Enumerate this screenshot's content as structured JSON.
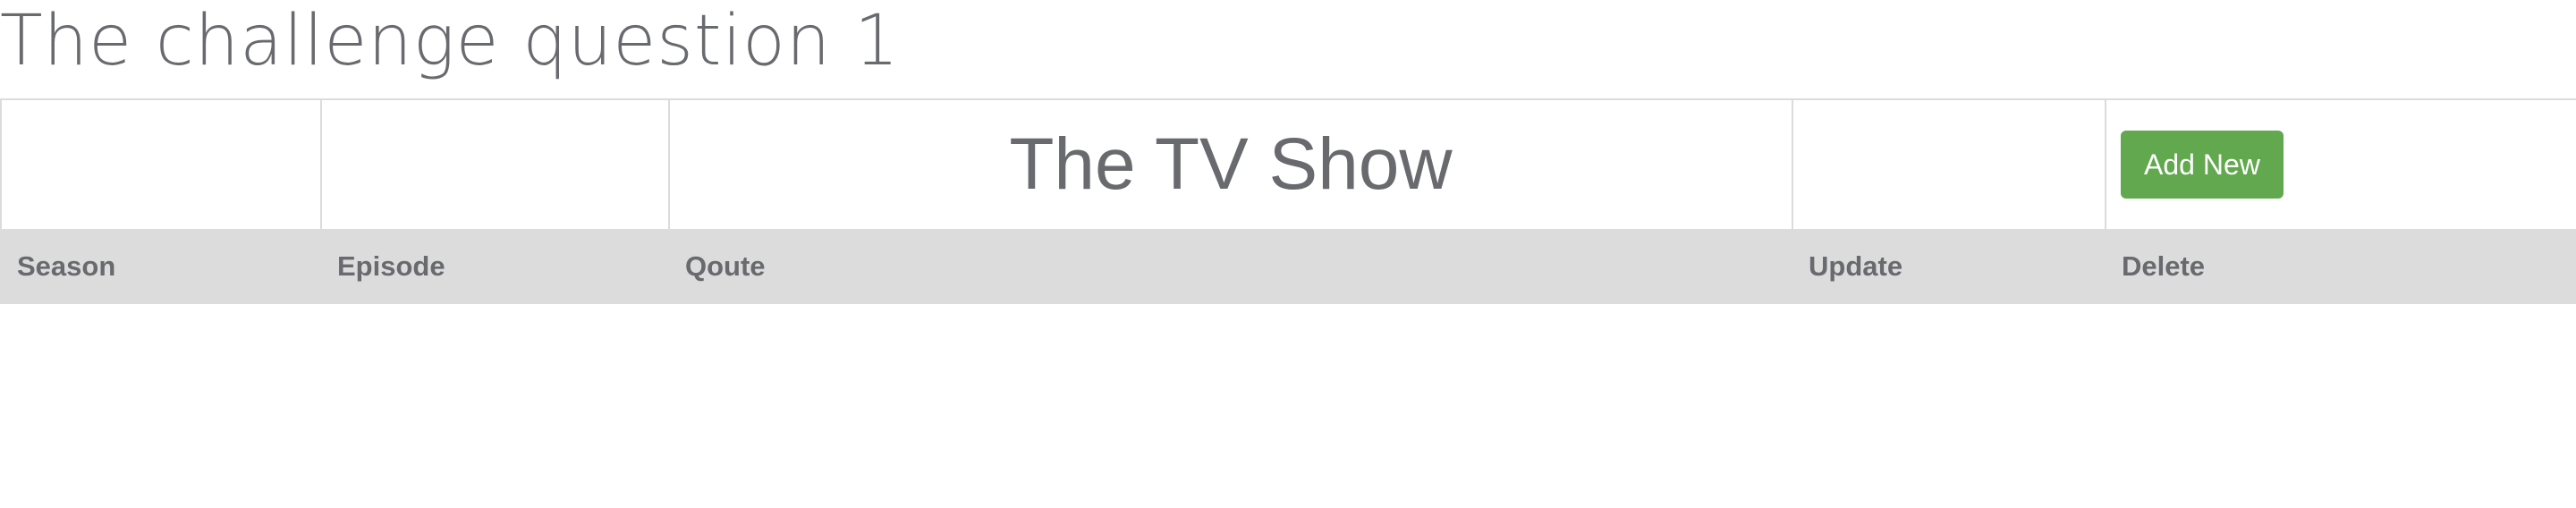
{
  "page": {
    "title": "The challenge question 1"
  },
  "table": {
    "heading": "The TV Show",
    "add_button_label": "Add New",
    "columns": [
      "Season",
      "Episode",
      "Qoute",
      "Update",
      "Delete"
    ],
    "rows": []
  },
  "colors": {
    "text": "#696a6e",
    "header_bg": "#dcdcdc",
    "border": "#dcdcdc",
    "add_button": "#62a84e"
  }
}
